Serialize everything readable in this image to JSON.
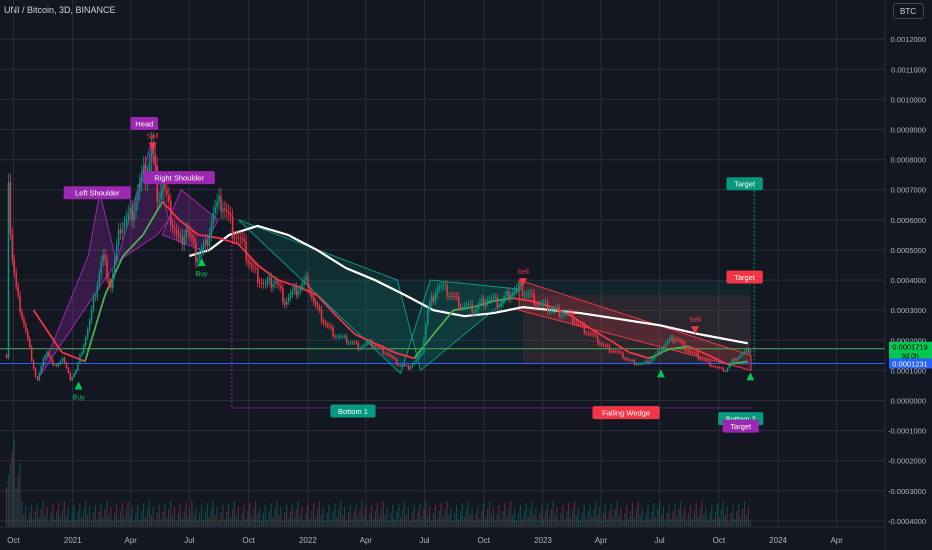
{
  "header": {
    "symbol_title": "UNI / Bitcoin, 3D, BINANCE",
    "currency": "BTC"
  },
  "chart_data": {
    "type": "line",
    "title": "UNI / Bitcoin, 3D, BINANCE",
    "ylim": [
      -0.00042,
      0.00133
    ],
    "y_ticks": [
      {
        "value": 0.0012,
        "label": "0.0012000"
      },
      {
        "value": 0.0011,
        "label": "0.0011000"
      },
      {
        "value": 0.001,
        "label": "0.0010000"
      },
      {
        "value": 0.0009,
        "label": "0.0009000"
      },
      {
        "value": 0.0008,
        "label": "0.0008000"
      },
      {
        "value": 0.0007,
        "label": "0.0007000"
      },
      {
        "value": 0.0006,
        "label": "0.0006000"
      },
      {
        "value": 0.0005,
        "label": "0.0005000"
      },
      {
        "value": 0.0004,
        "label": "0.0004000"
      },
      {
        "value": 0.0003,
        "label": "0.0003000"
      },
      {
        "value": 0.0002,
        "label": "0.0002000"
      },
      {
        "value": 0.0001,
        "label": "0.0001000"
      },
      {
        "value": 0.0,
        "label": "0.0000000"
      },
      {
        "value": -0.0001,
        "label": "-0.0001000"
      },
      {
        "value": -0.0002,
        "label": "-0.0002000"
      },
      {
        "value": -0.0003,
        "label": "-0.0003000"
      },
      {
        "value": -0.0004,
        "label": "-0.0004000"
      }
    ],
    "x_range": [
      "2020-09-10",
      "2024-06-15"
    ],
    "x_ticks": [
      {
        "date": "2020-10-01",
        "label": "Oct"
      },
      {
        "date": "2021-01-01",
        "label": "2021"
      },
      {
        "date": "2021-04-01",
        "label": "Apr"
      },
      {
        "date": "2021-07-01",
        "label": "Jul"
      },
      {
        "date": "2021-10-01",
        "label": "Oct"
      },
      {
        "date": "2022-01-01",
        "label": "2022"
      },
      {
        "date": "2022-04-01",
        "label": "Apr"
      },
      {
        "date": "2022-07-01",
        "label": "Jul"
      },
      {
        "date": "2022-10-01",
        "label": "Oct"
      },
      {
        "date": "2023-01-01",
        "label": "2023"
      },
      {
        "date": "2023-04-01",
        "label": "Apr"
      },
      {
        "date": "2023-07-01",
        "label": "Jul"
      },
      {
        "date": "2023-10-01",
        "label": "Oct"
      },
      {
        "date": "2024-01-01",
        "label": "2024"
      },
      {
        "date": "2024-04-01",
        "label": "Apr"
      }
    ],
    "price_series": {
      "name": "",
      "points": [
        [
          "2020-09-19",
          0.00015
        ],
        [
          "2020-09-22",
          0.00075
        ],
        [
          "2020-09-26",
          0.0005
        ],
        [
          "2020-10-05",
          0.00035
        ],
        [
          "2020-10-20",
          0.00022
        ],
        [
          "2020-11-05",
          6e-05
        ],
        [
          "2020-11-20",
          0.00017
        ],
        [
          "2020-12-01",
          0.00011
        ],
        [
          "2020-12-15",
          0.00014
        ],
        [
          "2020-12-27",
          7e-05
        ],
        [
          "2021-01-05",
          0.0001
        ],
        [
          "2021-01-25",
          0.00025
        ],
        [
          "2021-02-15",
          0.00048
        ],
        [
          "2021-02-28",
          0.00038
        ],
        [
          "2021-03-15",
          0.00058
        ],
        [
          "2021-04-01",
          0.00062
        ],
        [
          "2021-04-15",
          0.00072
        ],
        [
          "2021-04-28",
          0.00078
        ],
        [
          "2021-05-02",
          0.00085
        ],
        [
          "2021-05-12",
          0.00068
        ],
        [
          "2021-05-20",
          0.00072
        ],
        [
          "2021-05-30",
          0.00062
        ],
        [
          "2021-06-15",
          0.00052
        ],
        [
          "2021-06-25",
          0.00058
        ],
        [
          "2021-07-10",
          0.00048
        ],
        [
          "2021-07-25",
          0.00051
        ],
        [
          "2021-08-05",
          0.00062
        ],
        [
          "2021-08-20",
          0.00066
        ],
        [
          "2021-09-05",
          0.00057
        ],
        [
          "2021-09-20",
          0.00052
        ],
        [
          "2021-10-05",
          0.00044
        ],
        [
          "2021-10-25",
          0.00038
        ],
        [
          "2021-11-10",
          0.0004
        ],
        [
          "2021-11-25",
          0.00033
        ],
        [
          "2021-12-10",
          0.00036
        ],
        [
          "2021-12-30",
          0.0004
        ],
        [
          "2022-01-10",
          0.00032
        ],
        [
          "2022-01-25",
          0.00026
        ],
        [
          "2022-02-10",
          0.00022
        ],
        [
          "2022-03-01",
          0.0002
        ],
        [
          "2022-03-20",
          0.00018
        ],
        [
          "2022-04-10",
          0.00019
        ],
        [
          "2022-05-01",
          0.00016
        ],
        [
          "2022-05-20",
          0.00012
        ],
        [
          "2022-06-05",
          0.00011
        ],
        [
          "2022-06-25",
          0.00015
        ],
        [
          "2022-07-05",
          0.0003
        ],
        [
          "2022-07-20",
          0.00038
        ],
        [
          "2022-08-05",
          0.00036
        ],
        [
          "2022-08-25",
          0.00032
        ],
        [
          "2022-09-15",
          0.0003
        ],
        [
          "2022-10-05",
          0.00034
        ],
        [
          "2022-10-25",
          0.00032
        ],
        [
          "2022-11-10",
          0.00036
        ],
        [
          "2022-11-25",
          0.00037
        ],
        [
          "2022-12-10",
          0.00035
        ],
        [
          "2022-12-25",
          0.00032
        ],
        [
          "2023-01-15",
          0.0003
        ],
        [
          "2023-02-05",
          0.00029
        ],
        [
          "2023-02-25",
          0.00025
        ],
        [
          "2023-03-15",
          0.00022
        ],
        [
          "2023-04-05",
          0.00018
        ],
        [
          "2023-04-25",
          0.00016
        ],
        [
          "2023-05-15",
          0.00013
        ],
        [
          "2023-06-05",
          0.00012
        ],
        [
          "2023-06-20",
          0.00014
        ],
        [
          "2023-07-10",
          0.00019
        ],
        [
          "2023-07-25",
          0.00021
        ],
        [
          "2023-08-10",
          0.00017
        ],
        [
          "2023-08-25",
          0.00015
        ],
        [
          "2023-09-10",
          0.00013
        ],
        [
          "2023-09-25",
          0.00011
        ],
        [
          "2023-10-10",
          0.0001
        ],
        [
          "2023-10-25",
          0.00014
        ],
        [
          "2023-11-10",
          0.00016
        ],
        [
          "2023-11-20",
          0.000172
        ]
      ]
    },
    "moving_average_long": {
      "color": "#ffffff",
      "points": [
        [
          "2021-07-01",
          0.00048
        ],
        [
          "2021-08-01",
          0.0005
        ],
        [
          "2021-09-01",
          0.00055
        ],
        [
          "2021-10-15",
          0.00058
        ],
        [
          "2021-12-01",
          0.00055
        ],
        [
          "2022-01-15",
          0.0005
        ],
        [
          "2022-03-01",
          0.00044
        ],
        [
          "2022-04-15",
          0.0004
        ],
        [
          "2022-06-01",
          0.00035
        ],
        [
          "2022-07-15",
          0.0003
        ],
        [
          "2022-09-01",
          0.00028
        ],
        [
          "2022-10-15",
          0.00029
        ],
        [
          "2022-12-01",
          0.00031
        ],
        [
          "2023-01-15",
          0.0003
        ],
        [
          "2023-03-01",
          0.00029
        ],
        [
          "2023-05-01",
          0.00027
        ],
        [
          "2023-07-01",
          0.00025
        ],
        [
          "2023-09-01",
          0.00022
        ],
        [
          "2023-11-15",
          0.00019
        ]
      ]
    },
    "moving_average_short": {
      "color_up": "#4caf50",
      "color_down": "#f23645",
      "points": [
        [
          "2020-11-01",
          0.0003
        ],
        [
          "2020-12-15",
          0.00016
        ],
        [
          "2021-01-20",
          0.00013
        ],
        [
          "2021-02-20",
          0.00035
        ],
        [
          "2021-03-20",
          0.00048
        ],
        [
          "2021-04-20",
          0.00055
        ],
        [
          "2021-05-20",
          0.00066
        ],
        [
          "2021-06-15",
          0.0006
        ],
        [
          "2021-07-15",
          0.00055
        ],
        [
          "2021-08-15",
          0.00054
        ],
        [
          "2021-09-15",
          0.00052
        ],
        [
          "2021-10-15",
          0.00045
        ],
        [
          "2021-11-15",
          0.0004
        ],
        [
          "2021-12-15",
          0.00038
        ],
        [
          "2022-01-15",
          0.00035
        ],
        [
          "2022-02-15",
          0.00028
        ],
        [
          "2022-03-15",
          0.00022
        ],
        [
          "2022-04-15",
          0.00019
        ],
        [
          "2022-05-15",
          0.00016
        ],
        [
          "2022-06-15",
          0.00014
        ],
        [
          "2022-07-15",
          0.00022
        ],
        [
          "2022-08-15",
          0.0003
        ],
        [
          "2022-09-15",
          0.00031
        ],
        [
          "2022-10-15",
          0.00033
        ],
        [
          "2022-11-15",
          0.00034
        ],
        [
          "2022-12-15",
          0.00033
        ],
        [
          "2023-01-15",
          0.00031
        ],
        [
          "2023-02-15",
          0.00028
        ],
        [
          "2023-03-15",
          0.00024
        ],
        [
          "2023-04-15",
          0.0002
        ],
        [
          "2023-05-15",
          0.00016
        ],
        [
          "2023-06-15",
          0.00014
        ],
        [
          "2023-07-15",
          0.00017
        ],
        [
          "2023-08-15",
          0.00018
        ],
        [
          "2023-09-15",
          0.00015
        ],
        [
          "2023-10-15",
          0.00012
        ],
        [
          "2023-11-15",
          0.00013
        ]
      ]
    },
    "horizontal_lines": [
      {
        "value": 0.000172,
        "color": "#4caf50"
      },
      {
        "value": 0.0001231,
        "color": "#2962ff"
      }
    ],
    "price_labels": [
      {
        "value": 0.000172,
        "text": "0.0001719",
        "subtext": "3d 0h",
        "color": "#00c853",
        "text_color": "#000000"
      },
      {
        "value": 0.0001231,
        "text": "0.0001231",
        "color": "#2962ff",
        "text_color": "#ffffff"
      }
    ],
    "annotations": [
      {
        "text": "Left Shoulder",
        "date": "2021-02-08",
        "value": 0.00069,
        "color": "#9c27b0",
        "text_color": "#ffffff"
      },
      {
        "text": "Head",
        "date": "2021-04-22",
        "value": 0.00092,
        "color": "#9c27b0",
        "text_color": "#ffffff"
      },
      {
        "text": "Right Shoulder",
        "date": "2021-06-15",
        "value": 0.00074,
        "color": "#9c27b0",
        "text_color": "#ffffff"
      },
      {
        "text": "Bottom 1",
        "date": "2022-03-12",
        "value": -3.5e-05,
        "color": "#089981",
        "text_color": "#ffffff"
      },
      {
        "text": "Falling Wedge",
        "date": "2023-05-10",
        "value": -4e-05,
        "color": "#f23645",
        "text_color": "#ffffff"
      },
      {
        "text": "Bottom 2",
        "date": "2023-11-04",
        "value": -6e-05,
        "color": "#089981",
        "text_color": "#ffffff"
      },
      {
        "text": "Target",
        "date": "2023-11-04",
        "value": -8.5e-05,
        "color": "#9c27b0",
        "text_color": "#ffffff"
      },
      {
        "text": "Target",
        "date": "2023-11-10",
        "value": 0.00072,
        "color": "#089981",
        "text_color": "#ffffff"
      },
      {
        "text": "Target",
        "date": "2023-11-10",
        "value": 0.00041,
        "color": "#f23645",
        "text_color": "#ffffff"
      }
    ],
    "signals": [
      {
        "text": "Buy",
        "type": "buy",
        "date": "2021-01-10",
        "value": 7e-05
      },
      {
        "text": "Buy",
        "type": "buy",
        "date": "2021-07-20",
        "value": 0.00048
      },
      {
        "text": "Sell",
        "type": "sell",
        "date": "2021-05-05",
        "value": 0.00085
      },
      {
        "text": "Sell",
        "type": "sell",
        "date": "2022-12-01",
        "value": 0.0004
      },
      {
        "text": "Sell",
        "type": "sell",
        "date": "2023-08-25",
        "value": 0.00024
      },
      {
        "text": "",
        "type": "buy",
        "date": "2023-07-03",
        "value": 0.00011
      },
      {
        "text": "",
        "type": "buy",
        "date": "2023-11-19",
        "value": 0.0001
      }
    ]
  },
  "colors": {
    "background": "#131722",
    "grid": "#2a2e39",
    "axis_text": "#b2b5be",
    "green": "#089981",
    "red": "#f23645",
    "purple": "#9c27b0"
  }
}
